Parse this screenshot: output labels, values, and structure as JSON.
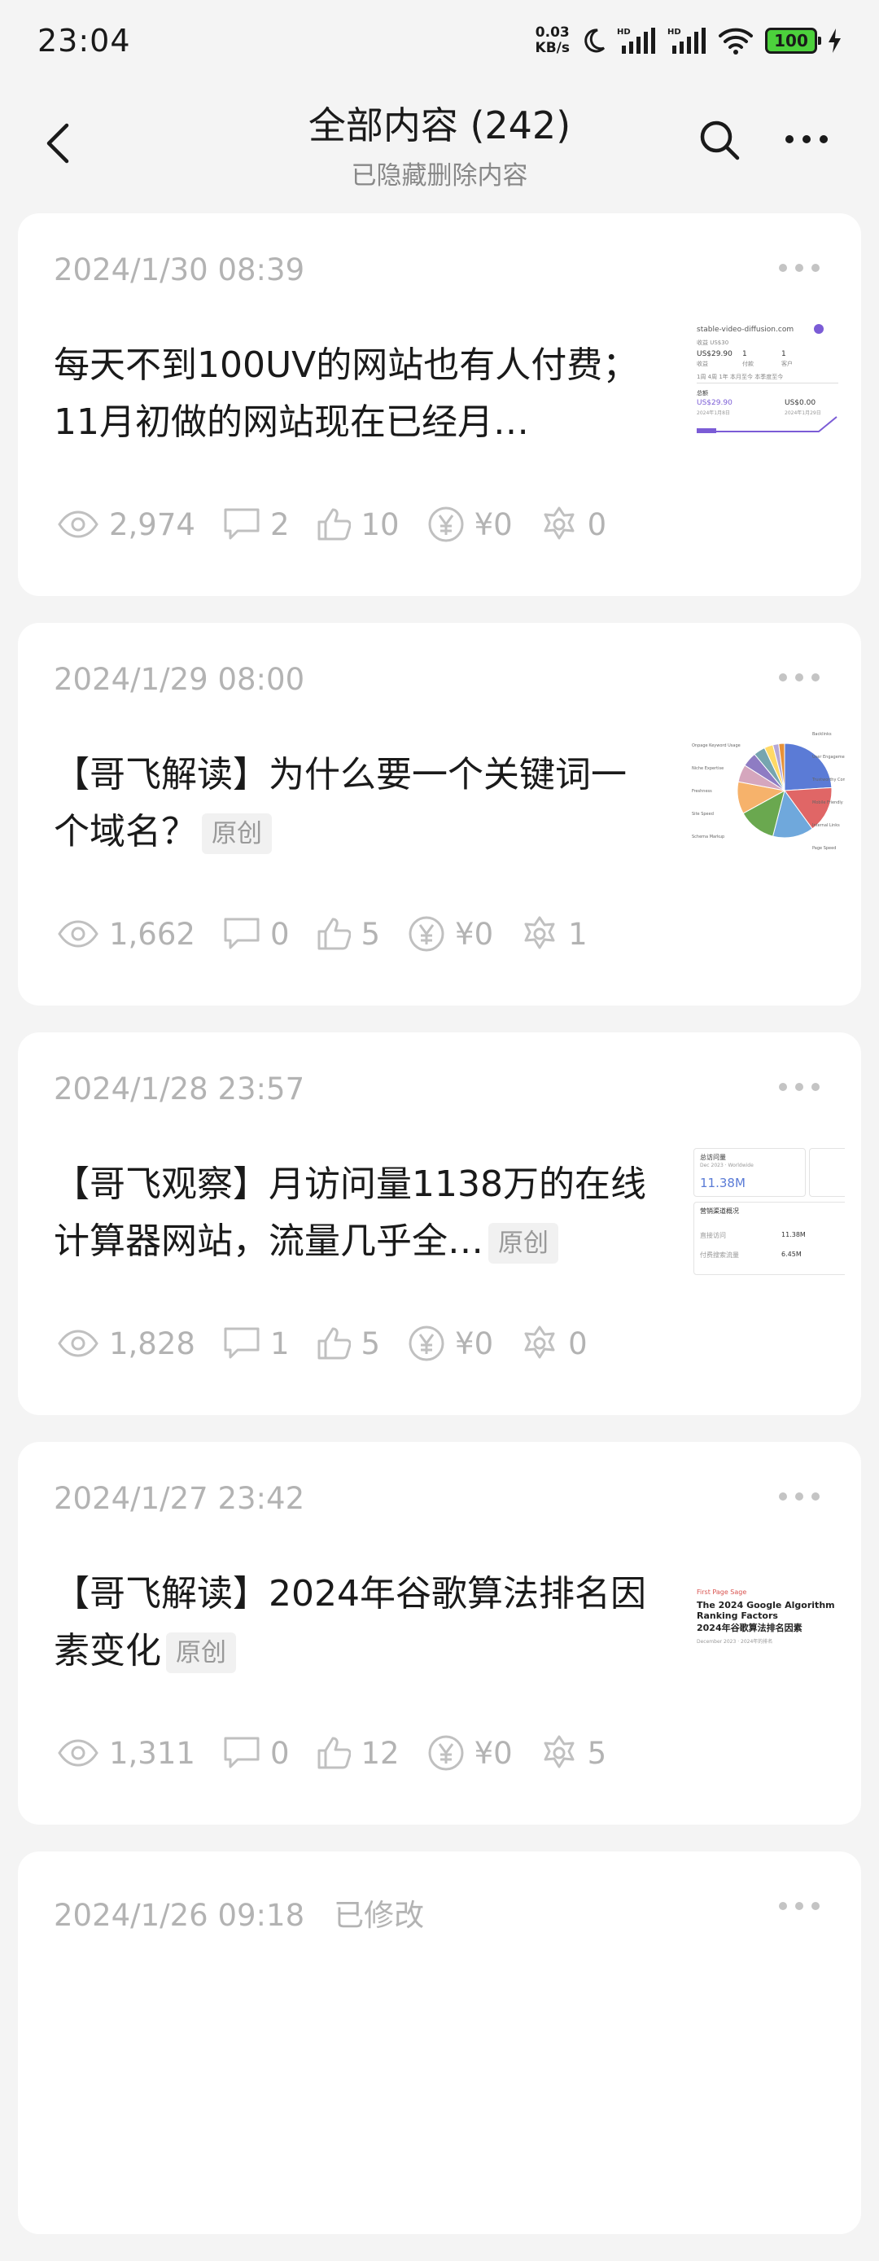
{
  "status_bar": {
    "time": "23:04",
    "net_speed_value": "0.03",
    "net_speed_unit": "KB/s",
    "battery": "100",
    "icons": [
      "moon-icon",
      "signal-hd-icon",
      "signal-hd-icon",
      "wifi-icon",
      "battery-icon",
      "charging-icon"
    ]
  },
  "header": {
    "title": "全部内容 (242)",
    "subtitle": "已隐藏删除内容",
    "icons": [
      "back-arrow-icon",
      "search-icon",
      "more-icon"
    ]
  },
  "posts": [
    {
      "date": "2024/1/30 08:39",
      "modified": "",
      "title": "每天不到100UV的网站也有人付费；11月初做的网站现在已经月…",
      "tag": "",
      "views": "2,974",
      "comments": "2",
      "likes": "10",
      "earnings": "¥0",
      "shares": "0",
      "thumb": {
        "url": "stable-video-diffusion.com",
        "r1": "收益 US$30",
        "r2a": "US$29.90",
        "r2b": "1",
        "r2c": "1",
        "r3a": "收益",
        "r3b": "付款",
        "r3c": "客户",
        "tabs": "1周   4周   1年   本月至今   本季度至今",
        "r4": "总额",
        "r5a": "US$29.90",
        "r5b": "US$0.00",
        "r6a": "2024年1月8日",
        "r6b": "2024年1月29日"
      }
    },
    {
      "date": "2024/1/29 08:00",
      "modified": "",
      "title": "【哥飞解读】为什么要一个关键词一个域名？",
      "tag": "原创",
      "views": "1,662",
      "comments": "0",
      "likes": "5",
      "earnings": "¥0",
      "shares": "1",
      "thumb": {
        "slice_labels": [
          "Backlinks",
          "Onpage Keyword Usage",
          "User Engagement",
          "Niche Expertise",
          "Trustworthy Content",
          "Freshness",
          "Mobile Friendly",
          "Site Speed",
          "Internal Links",
          "Schema Markup",
          "Page Speed"
        ],
        "slice_colors": [
          "#5b7bd6",
          "#e06666",
          "#6fa8dc",
          "#6aa84f",
          "#f6b26b",
          "#d5a6bd",
          "#8e7cc3",
          "#76a5af",
          "#ffd966",
          "#b4a7d6",
          "#e69138"
        ]
      }
    },
    {
      "date": "2024/1/28 23:57",
      "modified": "",
      "title": "【哥飞观察】月访问量1138万的在线计算器网站，流量几乎全…",
      "tag": "原创",
      "views": "1,828",
      "comments": "1",
      "likes": "5",
      "earnings": "¥0",
      "shares": "0",
      "thumb": {
        "label1": "总访问量",
        "label1_sub": "Dec 2023 · Worldwide",
        "value1": "11.38M",
        "label2": "营销渠道概况",
        "row1": "直接访问",
        "row1_val": "11.38M",
        "row2": "付费搜索流量",
        "row2_val": "6.45M"
      }
    },
    {
      "date": "2024/1/27 23:42",
      "modified": "",
      "title": "【哥飞解读】2024年谷歌算法排名因素变化",
      "tag": "原创",
      "views": "1,311",
      "comments": "0",
      "likes": "12",
      "earnings": "¥0",
      "shares": "5",
      "thumb": {
        "small": "First Page Sage",
        "heading": "The 2024 Google Algorithm Ranking Factors",
        "heading_cn": "2024年谷歌算法排名因素",
        "sub": "December 2023 · 2024年的排名"
      }
    },
    {
      "date": "2024/1/26 09:18",
      "modified": "已修改",
      "title": "",
      "tag": "",
      "views": "",
      "comments": "",
      "likes": "",
      "earnings": "",
      "shares": ""
    }
  ],
  "colors": {
    "background": "#f4f4f4",
    "card": "#ffffff",
    "muted": "#b3b3b3",
    "battery": "#4cd13c",
    "accent": "#7b5cd6"
  }
}
